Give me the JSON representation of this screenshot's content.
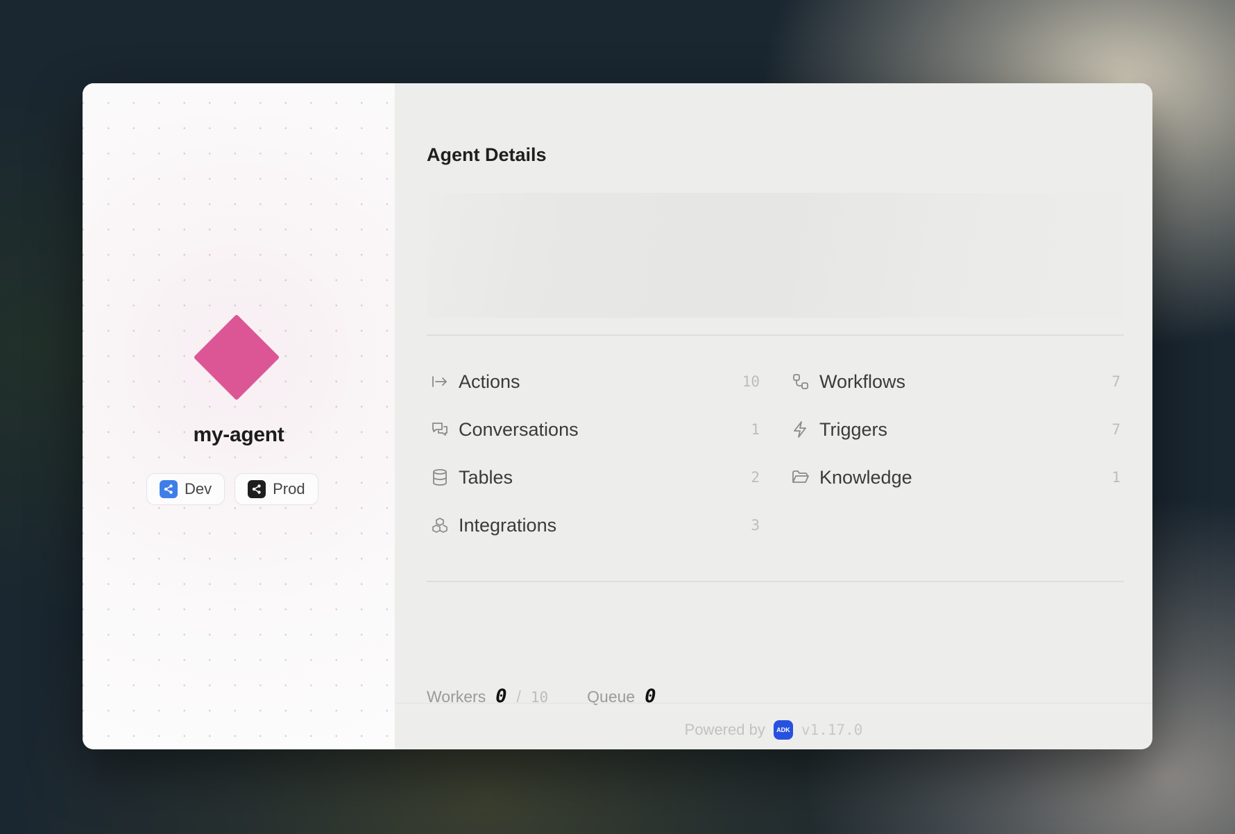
{
  "agent": {
    "name": "my-agent",
    "color": "#dc5696",
    "environments": [
      {
        "label": "Dev",
        "icon": "share-icon",
        "color": "#3f7ee8"
      },
      {
        "label": "Prod",
        "icon": "share-icon",
        "color": "#1e1e1e"
      }
    ]
  },
  "details": {
    "title": "Agent Details",
    "items": [
      {
        "label": "Actions",
        "count": "10",
        "icon": "arrow-right-to-line-icon"
      },
      {
        "label": "Workflows",
        "count": "7",
        "icon": "workflow-icon"
      },
      {
        "label": "Conversations",
        "count": "1",
        "icon": "chat-bubbles-icon"
      },
      {
        "label": "Triggers",
        "count": "7",
        "icon": "lightning-icon"
      },
      {
        "label": "Tables",
        "count": "2",
        "icon": "database-icon"
      },
      {
        "label": "Knowledge",
        "count": "1",
        "icon": "folder-open-icon"
      },
      {
        "label": "Integrations",
        "count": "3",
        "icon": "boxes-icon"
      }
    ]
  },
  "stats": {
    "workers_label": "Workers",
    "workers_value": "0",
    "workers_separator": "/",
    "workers_capacity": "10",
    "queue_label": "Queue",
    "queue_value": "0"
  },
  "footer": {
    "powered_by": "Powered by",
    "badge": "ADK",
    "version": "v1.17.0"
  }
}
